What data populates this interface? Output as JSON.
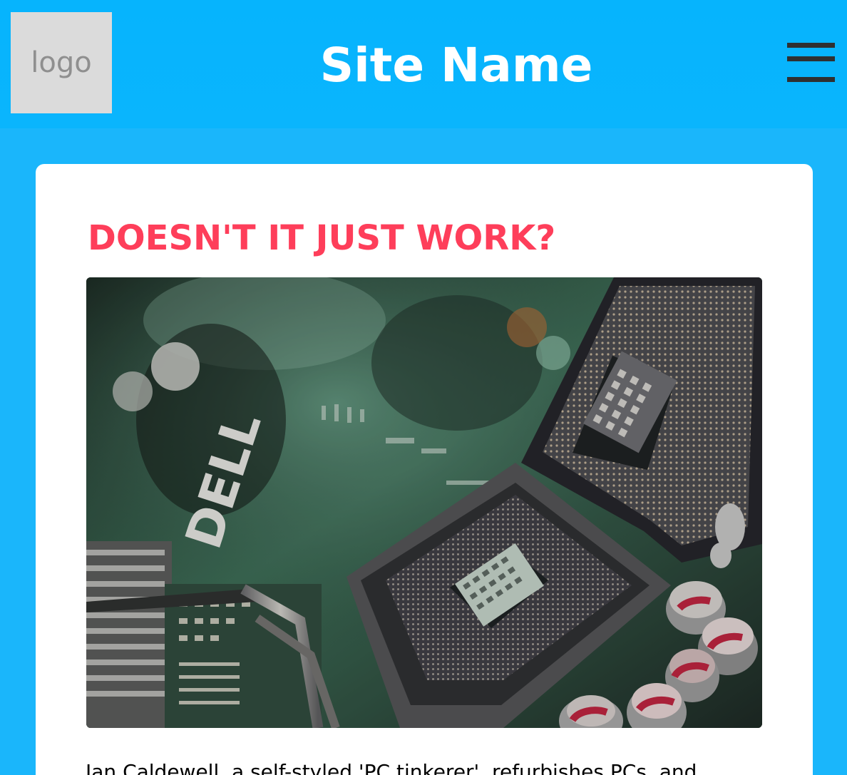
{
  "header": {
    "logo_text": "logo",
    "site_name": "Site Name"
  },
  "menu": {
    "icon": "hamburger-menu-icon"
  },
  "article": {
    "title": "DOESN'T IT JUST WORK?",
    "paragraph_first_line": "Ian Caldewell, a self-styled 'PC tinkerer', refurbishes PCs, and"
  },
  "image": {
    "subject": "motherboard CPU socket"
  },
  "colors": {
    "header_background": "#06b4fd",
    "page_background": "#1ab6fb",
    "title": "#fe3e5a",
    "card_background": "#ffffff",
    "logo_background": "#dbdbdb",
    "menu_icon": "#2f3031"
  }
}
